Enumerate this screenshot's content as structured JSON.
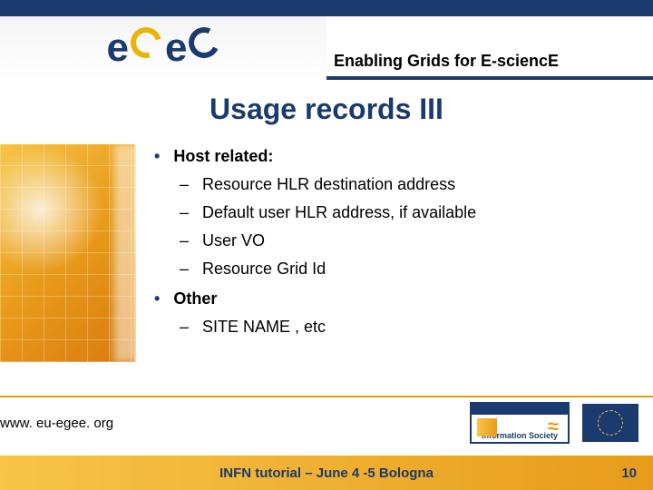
{
  "header": {
    "logo_text": "eGee",
    "tagline": "Enabling Grids for E-sciencE"
  },
  "title": "Usage records III",
  "content": {
    "bullets": [
      {
        "label": "Host related:",
        "items": [
          "Resource HLR destination address",
          "Default user  HLR address, if available",
          "User VO",
          " Resource Grid Id"
        ]
      },
      {
        "label": "Other",
        "items": [
          "SITE NAME , etc"
        ]
      }
    ]
  },
  "footer": {
    "url": "www. eu-egee. org",
    "info_society_label": "Information Society",
    "caption": "INFN tutorial – June 4 -5 Bologna",
    "page_number": "10"
  }
}
